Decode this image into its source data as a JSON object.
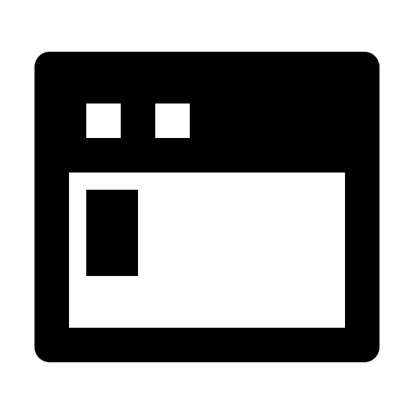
{
  "icon": {
    "name": "browser-window-icon",
    "colors": {
      "foreground": "#000000",
      "background": "#ffffff"
    }
  }
}
